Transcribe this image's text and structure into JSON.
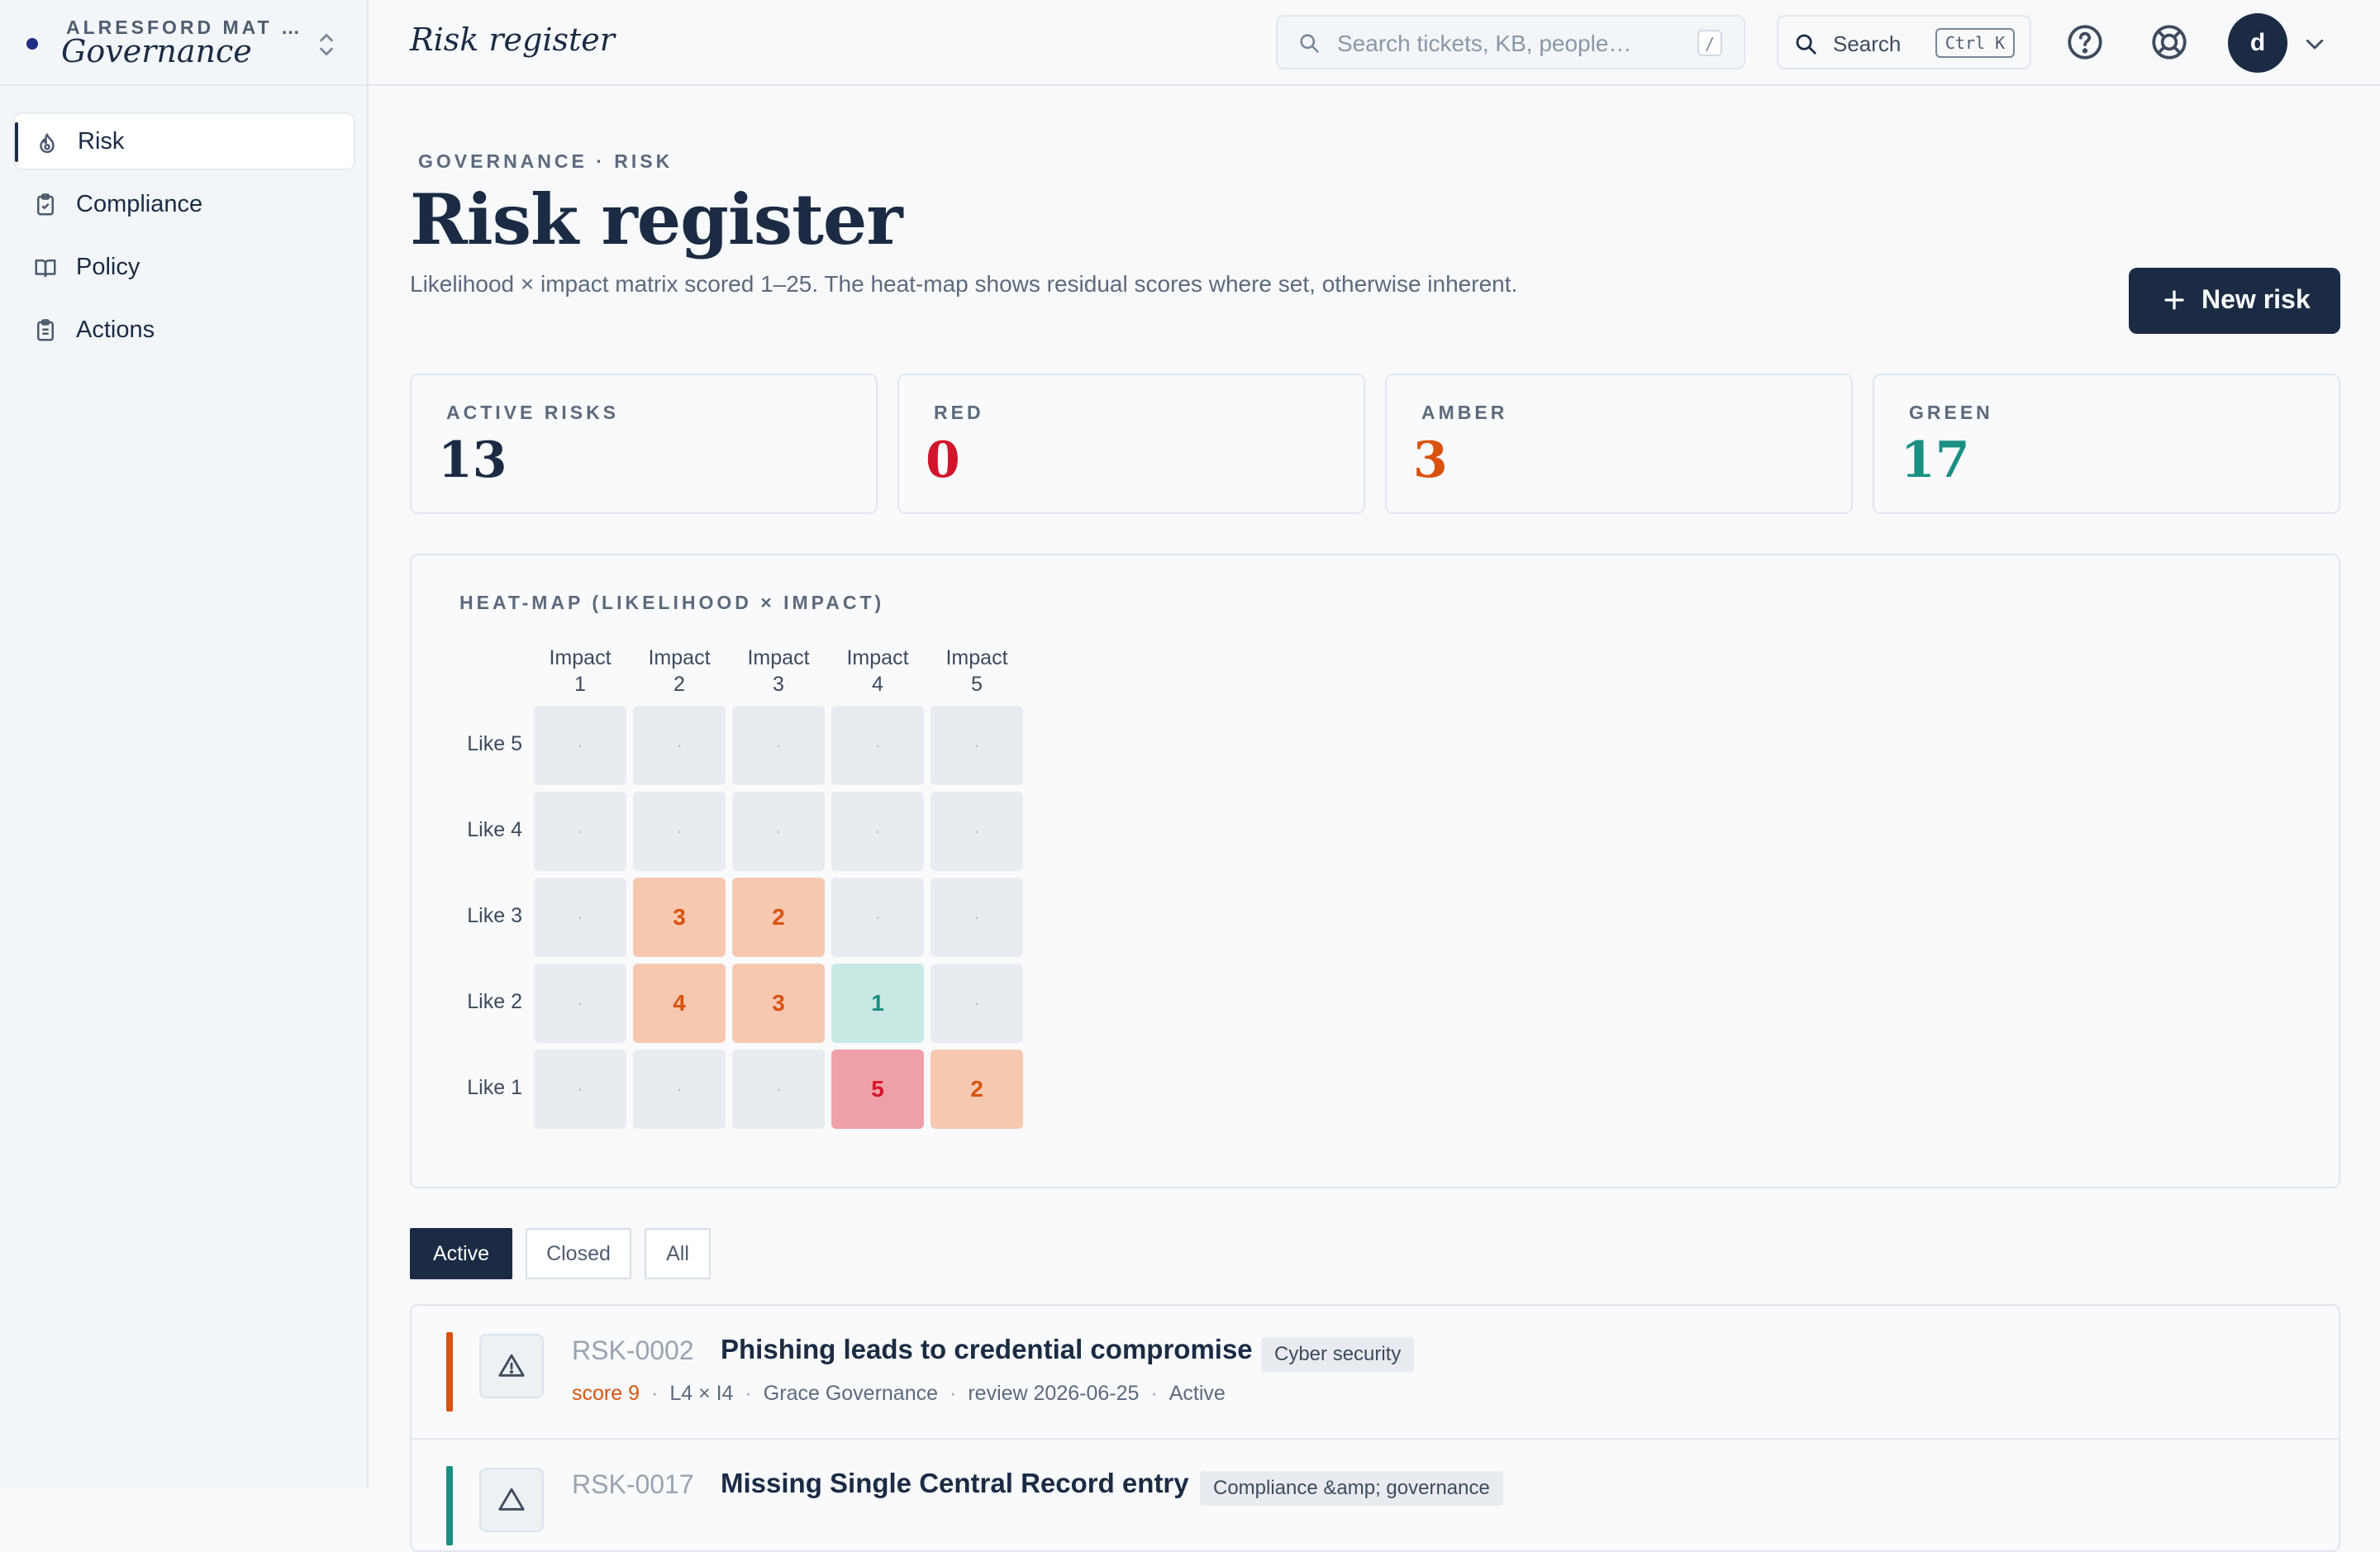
{
  "org": {
    "name": "ALRESFORD MAT …",
    "module": "Governance"
  },
  "sidebar": {
    "items": [
      {
        "label": "Risk",
        "icon": "flame-icon",
        "active": true
      },
      {
        "label": "Compliance",
        "icon": "clipboard-check-icon",
        "active": false
      },
      {
        "label": "Policy",
        "icon": "book-icon",
        "active": false
      },
      {
        "label": "Actions",
        "icon": "clipboard-list-icon",
        "active": false
      }
    ]
  },
  "topbar": {
    "title": "Risk register",
    "search_placeholder": "Search tickets, KB, people…",
    "search_shortcut": "/",
    "command_label": "Search",
    "command_shortcut": "Ctrl K",
    "avatar_initial": "d"
  },
  "page": {
    "breadcrumb": "GOVERNANCE · RISK",
    "title": "Risk register",
    "description": "Likelihood × impact matrix scored 1–25. The heat-map shows residual scores where set, otherwise inherent.",
    "new_button": "New risk"
  },
  "stats": [
    {
      "label": "ACTIVE RISKS",
      "value": "13",
      "color": "#1b2b44"
    },
    {
      "label": "RED",
      "value": "0",
      "color": "#d1162b"
    },
    {
      "label": "AMBER",
      "value": "3",
      "color": "#d9530f"
    },
    {
      "label": "GREEN",
      "value": "17",
      "color": "#1a8f83"
    }
  ],
  "heatmap": {
    "title": "HEAT-MAP (LIKELIHOOD × IMPACT)",
    "columns": [
      "Impact\n1",
      "Impact\n2",
      "Impact\n3",
      "Impact\n4",
      "Impact\n5"
    ],
    "rows": [
      {
        "label": "Like 5",
        "cells": [
          "·",
          "·",
          "·",
          "·",
          "·"
        ]
      },
      {
        "label": "Like 4",
        "cells": [
          "·",
          "·",
          "·",
          "·",
          "·"
        ]
      },
      {
        "label": "Like 3",
        "cells": [
          "·",
          "3",
          "2",
          "·",
          "·"
        ]
      },
      {
        "label": "Like 2",
        "cells": [
          "·",
          "4",
          "3",
          "1",
          "·"
        ]
      },
      {
        "label": "Like 1",
        "cells": [
          "·",
          "·",
          "·",
          "5",
          "2"
        ]
      }
    ],
    "colors": {
      "empty": "#e8ebef",
      "amber_bg": "#f6c8b0",
      "amber_fg": "#d9530f",
      "green_bg": "#c8e8e4",
      "green_fg": "#1a8f83",
      "red_bg": "#f0a0a8",
      "red_fg": "#d1162b"
    }
  },
  "filters": [
    {
      "label": "Active",
      "active": true
    },
    {
      "label": "Closed",
      "active": false
    },
    {
      "label": "All",
      "active": false
    }
  ],
  "risks": [
    {
      "id": "RSK-0002",
      "title": "Phishing leads to credential compromise",
      "tag": "Cyber security",
      "score": "score 9",
      "matrix": "L4 × I4",
      "owner": "Grace Governance",
      "review": "review 2026-06-25",
      "status": "Active",
      "bar_color": "#d9530f"
    },
    {
      "id": "RSK-0017",
      "title": "Missing Single Central Record entry",
      "tag": "Compliance &amp; governance",
      "bar_color": "#1a8f83"
    }
  ]
}
